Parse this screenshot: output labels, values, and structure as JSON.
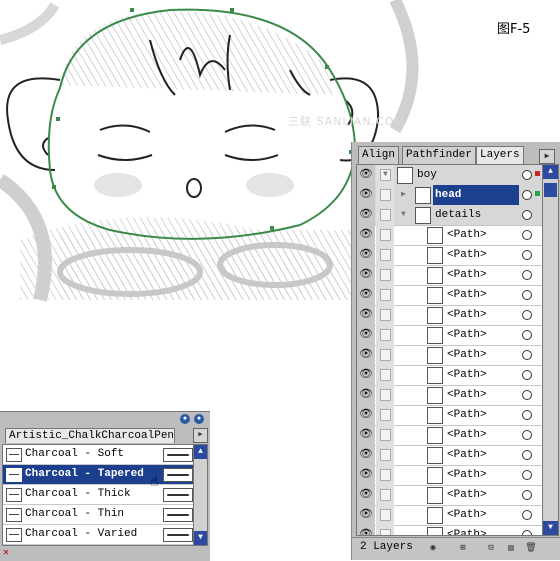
{
  "figure_label": "图F-5",
  "watermark": "三联 SANLIAN.COM",
  "layers_panel": {
    "tabs": [
      "Align",
      "Pathfinder",
      "Layers"
    ],
    "active_tab": "Layers",
    "rows": [
      {
        "name": "boy",
        "type": "layer"
      },
      {
        "name": "head",
        "type": "sublayer",
        "selected": true
      },
      {
        "name": "details",
        "type": "sublayer"
      },
      {
        "name": "<Path>",
        "type": "path"
      },
      {
        "name": "<Path>",
        "type": "path"
      },
      {
        "name": "<Path>",
        "type": "path"
      },
      {
        "name": "<Path>",
        "type": "path"
      },
      {
        "name": "<Path>",
        "type": "path"
      },
      {
        "name": "<Path>",
        "type": "path"
      },
      {
        "name": "<Path>",
        "type": "path"
      },
      {
        "name": "<Path>",
        "type": "path"
      },
      {
        "name": "<Path>",
        "type": "path"
      },
      {
        "name": "<Path>",
        "type": "path"
      },
      {
        "name": "<Path>",
        "type": "path"
      },
      {
        "name": "<Path>",
        "type": "path"
      },
      {
        "name": "<Path>",
        "type": "path"
      },
      {
        "name": "<Path>",
        "type": "path"
      },
      {
        "name": "<Path>",
        "type": "path"
      },
      {
        "name": "<Path>",
        "type": "path"
      }
    ],
    "footer_count": "2 Layers"
  },
  "brushes_panel": {
    "tab_label": "Artistic_ChalkCharcoalPenci",
    "items": [
      {
        "name": "Charcoal - Soft"
      },
      {
        "name": "Charcoal - Tapered",
        "selected": true
      },
      {
        "name": "Charcoal - Thick"
      },
      {
        "name": "Charcoal - Thin"
      },
      {
        "name": "Charcoal - Varied"
      }
    ]
  },
  "colors": {
    "selection": "#1c3f8e",
    "path_outline": "#3a8a4a",
    "accent_red": "#cc2222",
    "accent_green": "#22aa44"
  }
}
